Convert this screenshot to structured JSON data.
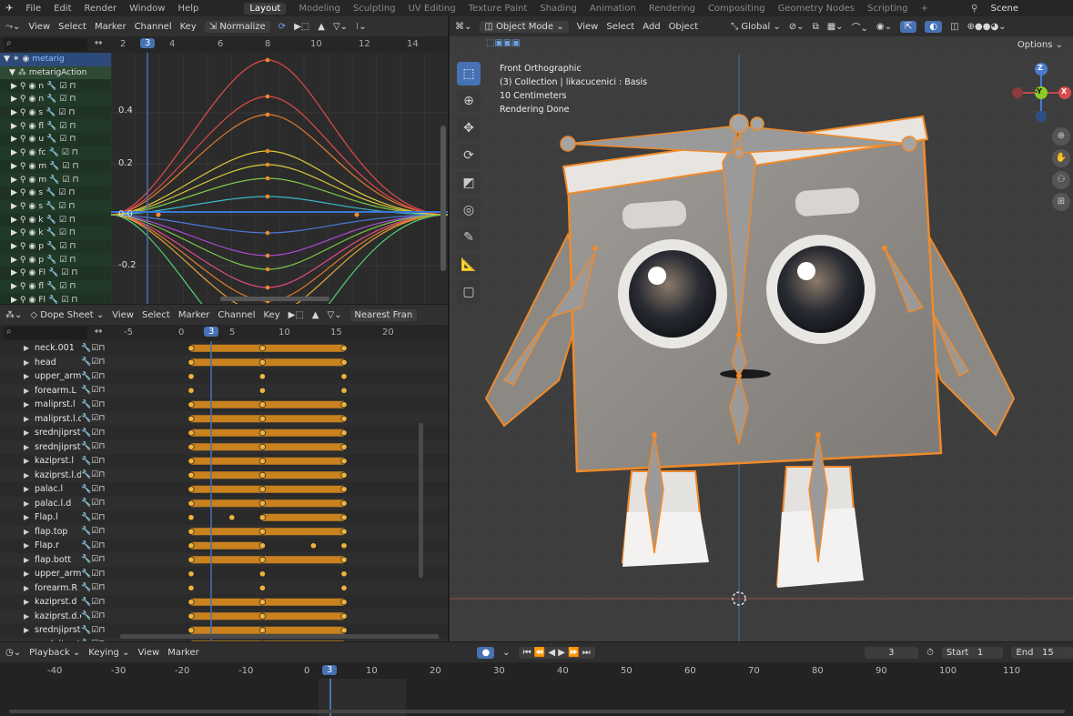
{
  "menu": {
    "items": [
      "File",
      "Edit",
      "Render",
      "Window",
      "Help"
    ],
    "workspaces": [
      "Layout",
      "Modeling",
      "Sculpting",
      "UV Editing",
      "Texture Paint",
      "Shading",
      "Animation",
      "Rendering",
      "Compositing",
      "Geometry Nodes",
      "Scripting",
      "+"
    ],
    "active_workspace": "Layout",
    "scene": "Scene"
  },
  "graph_editor": {
    "header": [
      "View",
      "Select",
      "Marker",
      "Channel",
      "Key"
    ],
    "normalize": "Normalize",
    "ruler": [
      "2",
      "3",
      "4",
      "6",
      "8",
      "10",
      "12",
      "14"
    ],
    "current_frame": "3",
    "y_labels": [
      "0.4",
      "0.2",
      "0.0",
      "-0.2"
    ],
    "channels": [
      {
        "label": "metarig",
        "kind": "object"
      },
      {
        "label": "metarigAction",
        "kind": "action"
      },
      {
        "label": "n"
      },
      {
        "label": "n"
      },
      {
        "label": "s"
      },
      {
        "label": "fl"
      },
      {
        "label": "u"
      },
      {
        "label": "fc"
      },
      {
        "label": "m"
      },
      {
        "label": "m"
      },
      {
        "label": "s"
      },
      {
        "label": "s"
      },
      {
        "label": "k"
      },
      {
        "label": "k"
      },
      {
        "label": "p"
      },
      {
        "label": "p"
      },
      {
        "label": "Fl"
      },
      {
        "label": "fl"
      },
      {
        "label": "Fl"
      },
      {
        "label": "fl"
      },
      {
        "label": "u"
      },
      {
        "label": "fc"
      },
      {
        "label": "k"
      },
      {
        "label": "k"
      }
    ]
  },
  "dope_sheet": {
    "mode": "Dope Sheet",
    "header": [
      "View",
      "Select",
      "Marker",
      "Channel",
      "Key"
    ],
    "interpolation": "Nearest Fran",
    "ruler": [
      "-5",
      "0",
      "3",
      "5",
      "10",
      "15",
      "20"
    ],
    "current_frame": "3",
    "rows": [
      {
        "name": "neck.001",
        "keys": [
          0,
          7,
          15
        ],
        "bar": [
          0,
          15
        ]
      },
      {
        "name": "head",
        "keys": [
          0,
          7,
          15
        ],
        "bar": [
          0,
          15
        ]
      },
      {
        "name": "upper_arm",
        "keys": [
          0,
          7,
          15
        ],
        "bar": []
      },
      {
        "name": "forearm.L",
        "keys": [
          0,
          7,
          15
        ],
        "bar": []
      },
      {
        "name": "maliprst.l",
        "keys": [
          0,
          7,
          15
        ],
        "bar": [
          0,
          15
        ]
      },
      {
        "name": "maliprst.l.c",
        "keys": [
          0,
          7,
          15
        ],
        "bar": [
          0,
          15
        ]
      },
      {
        "name": "srednjiprst.",
        "keys": [
          0,
          7,
          15
        ],
        "bar": [
          0,
          15
        ]
      },
      {
        "name": "srednjiprst.",
        "keys": [
          0,
          7,
          15
        ],
        "bar": [
          0,
          15
        ]
      },
      {
        "name": "kaziprst.l",
        "keys": [
          0,
          7,
          15
        ],
        "bar": [
          0,
          15
        ]
      },
      {
        "name": "kaziprst.l.d",
        "keys": [
          0,
          7,
          15
        ],
        "bar": [
          0,
          15
        ]
      },
      {
        "name": "palac.l",
        "keys": [
          0,
          7,
          15
        ],
        "bar": [
          0,
          15
        ]
      },
      {
        "name": "palac.l.d",
        "keys": [
          0,
          7,
          15
        ],
        "bar": [
          0,
          15
        ]
      },
      {
        "name": "Flap.l",
        "keys": [
          0,
          4,
          7,
          15
        ],
        "bar": [
          7,
          15
        ]
      },
      {
        "name": "flap.top",
        "keys": [
          0,
          7,
          15
        ],
        "bar": [
          0,
          15
        ]
      },
      {
        "name": "Flap.r",
        "keys": [
          0,
          7,
          12,
          15
        ],
        "bar": [
          0,
          7
        ]
      },
      {
        "name": "flap.bott",
        "keys": [
          0,
          7,
          15
        ],
        "bar": [
          0,
          15
        ]
      },
      {
        "name": "upper_arm",
        "keys": [
          0,
          7,
          15
        ],
        "bar": []
      },
      {
        "name": "forearm.R",
        "keys": [
          0,
          7,
          15
        ],
        "bar": []
      },
      {
        "name": "kaziprst.d",
        "keys": [
          0,
          7,
          15
        ],
        "bar": [
          0,
          15
        ]
      },
      {
        "name": "kaziprst.d.c",
        "keys": [
          0,
          7,
          15
        ],
        "bar": [
          0,
          15
        ]
      },
      {
        "name": "srednjiprst.",
        "keys": [
          0,
          7,
          15
        ],
        "bar": [
          0,
          15
        ]
      },
      {
        "name": "srednjiprst.",
        "keys": [
          0,
          7,
          15
        ],
        "bar": [
          0,
          15
        ]
      }
    ]
  },
  "viewport": {
    "mode": "Object Mode",
    "header": [
      "View",
      "Select",
      "Add",
      "Object"
    ],
    "transform": "Global",
    "options": "Options",
    "overlay_lines": [
      "Front Orthographic",
      "(3) Collection | likacucenici : Basis",
      "10 Centimeters",
      "Rendering Done"
    ],
    "gizmo_axes": [
      "Z",
      "-Y",
      "X"
    ]
  },
  "timeline": {
    "header": [
      "Playback",
      "Keying",
      "View",
      "Marker"
    ],
    "current_frame": "3",
    "start_label": "Start",
    "start": "1",
    "end_label": "End",
    "end": "15",
    "ruler": [
      "-40",
      "-30",
      "-20",
      "-10",
      "0",
      "3",
      "10",
      "20",
      "30",
      "40",
      "50",
      "60",
      "70",
      "80",
      "90",
      "100",
      "110"
    ]
  },
  "colors": {
    "accent": "#4772b3",
    "key": "#f0b43c",
    "bar": "#c9821e",
    "bone": "#9a9a9a",
    "outline": "#f08a2a"
  }
}
